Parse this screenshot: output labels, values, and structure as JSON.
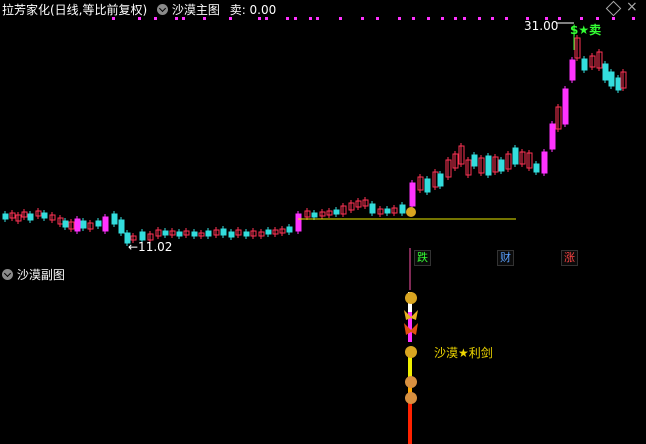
{
  "main_panel": {
    "title": "拉芳家化(日线,等比前复权)",
    "indicator_name": "沙漠主图",
    "sell_value": "卖: 0.00",
    "high_label": "31.00",
    "sell_signal": "$★卖",
    "low_label": "←11.02"
  },
  "signal_tags": [
    {
      "text": "跌",
      "color": "#33ff33"
    },
    {
      "text": "财",
      "color": "#5aa0ff"
    },
    {
      "text": "涨",
      "color": "#ff4444"
    }
  ],
  "sub_panel": {
    "title": "沙漠副图",
    "label": "沙漠★利剑"
  },
  "colors": {
    "up": "#ff3355",
    "up_fill": "#ff33ff",
    "down": "#33dddd",
    "support_line": "#e8e800",
    "dot": "#ff33ff"
  },
  "icons": [
    "chevron-down-icon",
    "diamond-icon",
    "close-icon",
    "money-bag-icon",
    "butterfly-icon",
    "monkey-icon"
  ]
}
